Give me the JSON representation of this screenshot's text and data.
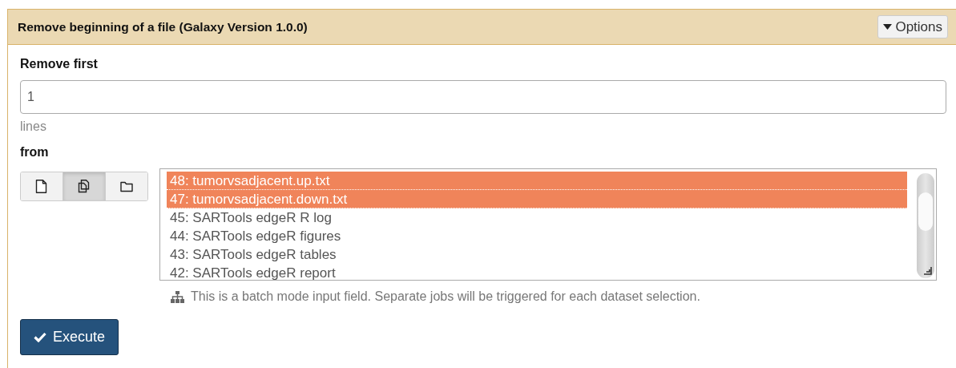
{
  "panel": {
    "title": "Remove beginning of a file (Galaxy Version 1.0.0)",
    "options_button": "Options"
  },
  "remove_first": {
    "label": "Remove first",
    "value": "1",
    "help": "lines"
  },
  "from": {
    "label": "from",
    "source_modes": [
      {
        "selected": false
      },
      {
        "selected": true
      },
      {
        "selected": false
      }
    ],
    "datasets": [
      {
        "label": "48: tumorvsadjacent.up.txt",
        "selected": true
      },
      {
        "label": "47: tumorvsadjacent.down.txt",
        "selected": true
      },
      {
        "label": "45: SARTools edgeR R log",
        "selected": false
      },
      {
        "label": "44: SARTools edgeR figures",
        "selected": false
      },
      {
        "label": "43: SARTools edgeR tables",
        "selected": false
      },
      {
        "label": "42: SARTools edgeR report",
        "selected": false
      }
    ],
    "batch_help": "This is a batch mode input field. Separate jobs will be triggered for each dataset selection."
  },
  "execute_button": "Execute"
}
